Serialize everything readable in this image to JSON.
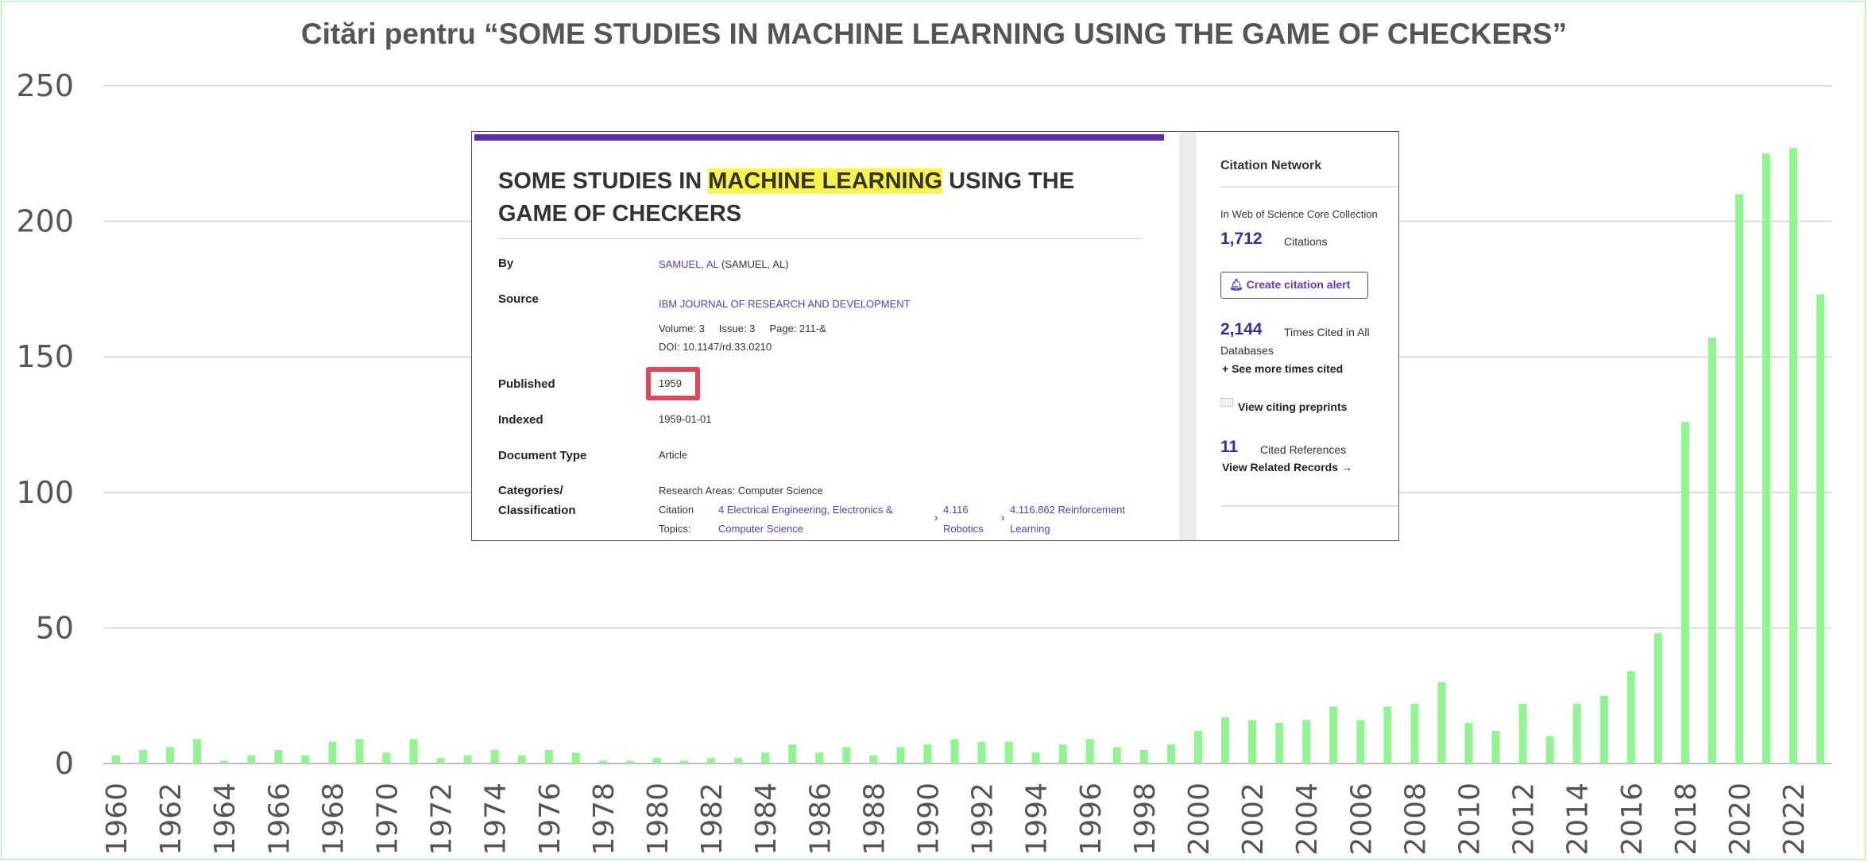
{
  "chart_data": {
    "type": "bar",
    "title": "Citări pentru “SOME STUDIES IN MACHINE LEARNING USING THE GAME OF CHECKERS”",
    "xlabel": "",
    "ylabel": "",
    "ylim": [
      0,
      250
    ],
    "yticks": [
      0,
      50,
      100,
      150,
      200,
      250
    ],
    "grid": true,
    "legend": "none",
    "bar_color": "#90f590",
    "categories": [
      1960,
      1961,
      1962,
      1963,
      1964,
      1965,
      1966,
      1967,
      1968,
      1969,
      1970,
      1971,
      1972,
      1973,
      1974,
      1975,
      1976,
      1977,
      1978,
      1979,
      1980,
      1981,
      1982,
      1983,
      1984,
      1985,
      1986,
      1987,
      1988,
      1989,
      1990,
      1991,
      1992,
      1993,
      1994,
      1995,
      1996,
      1997,
      1998,
      1999,
      2000,
      2001,
      2002,
      2003,
      2004,
      2005,
      2006,
      2007,
      2008,
      2009,
      2010,
      2011,
      2012,
      2013,
      2014,
      2015,
      2016,
      2017,
      2018,
      2019,
      2020,
      2021,
      2022,
      2023
    ],
    "xtick_labels": [
      "1960",
      "1962",
      "1964",
      "1966",
      "1968",
      "1970",
      "1972",
      "1974",
      "1976",
      "1978",
      "1980",
      "1982",
      "1984",
      "1986",
      "1988",
      "1990",
      "1992",
      "1994",
      "1996",
      "1998",
      "2000",
      "2002",
      "2004",
      "2006",
      "2008",
      "2010",
      "2012",
      "2014",
      "2016",
      "2018",
      "2020",
      "2022"
    ],
    "values": [
      3,
      5,
      6,
      9,
      1,
      3,
      5,
      3,
      8,
      9,
      4,
      9,
      2,
      3,
      5,
      3,
      5,
      4,
      1,
      1,
      2,
      1,
      2,
      2,
      4,
      7,
      4,
      6,
      3,
      6,
      7,
      9,
      8,
      8,
      4,
      7,
      9,
      6,
      5,
      7,
      12,
      17,
      16,
      15,
      16,
      21,
      16,
      21,
      22,
      30,
      15,
      12,
      22,
      10,
      22,
      25,
      34,
      48,
      126,
      157,
      210,
      225,
      227,
      173
    ]
  },
  "inset": {
    "title_pre": "SOME STUDIES IN ",
    "title_highlight": "MACHINE LEARNING",
    "title_post": " USING THE GAME OF CHECKERS",
    "by_label": "By",
    "author_link": "SAMUEL, AL",
    "author_rest": " (SAMUEL, AL)",
    "source_label": "Source",
    "journal": "IBM JOURNAL OF RESEARCH AND DEVELOPMENT",
    "volume_line": "Volume: 3     Issue: 3     Page: 211-&",
    "doi": "DOI: 10.1147/rd.33.0210",
    "published_label": "Published",
    "published_value": "1959",
    "indexed_label": "Indexed",
    "indexed_value": "1959-01-01",
    "doctype_label": "Document Type",
    "doctype_value": "Article",
    "categories_label_1": "Categories/",
    "categories_label_2": "Classification",
    "research_areas": "Research Areas: Computer Science",
    "citation_label_1": "Citation",
    "citation_label_2": "Topics:",
    "topic1_a": "4 Electrical Engineering, Electronics &",
    "topic1_b": "Computer Science",
    "topic2_a": "4.116",
    "topic2_b": "Robotics",
    "topic3_a": "4.116.862 Reinforcement",
    "topic3_b": "Learning",
    "sidebar": {
      "heading": "Citation Network",
      "collection": "In Web of Science Core Collection",
      "citations_num": "1,712",
      "citations_label": "Citations",
      "alert_button": "Create citation alert",
      "times_num": "2,144",
      "times_label_1": "Times Cited in All",
      "times_label_2": "Databases",
      "see_more": "+ See more times cited",
      "preprints": "View citing preprints",
      "refs_num": "11",
      "refs_label": "Cited References",
      "related": "View Related Records →"
    }
  }
}
